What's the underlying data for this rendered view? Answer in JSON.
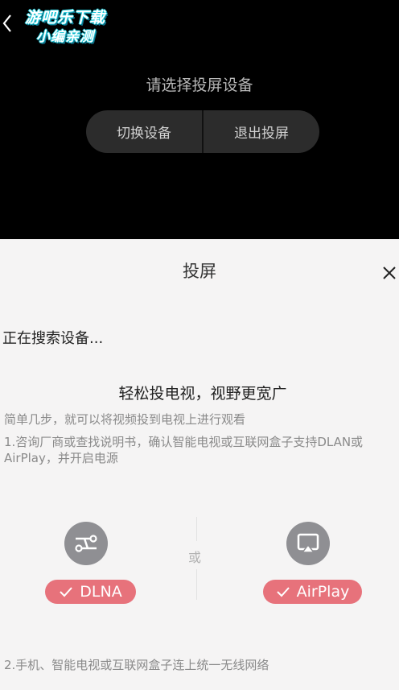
{
  "watermark": {
    "line1": "游吧乐下载",
    "line2": "小编亲测"
  },
  "player": {
    "back_icon": "chevron-left-icon",
    "prompt": "请选择投屏设备",
    "switch_device": "切换设备",
    "exit_cast": "退出投屏"
  },
  "sheet": {
    "title": "投屏",
    "close_icon": "close-icon",
    "searching": "正在搜索设备...",
    "headline": "轻松投电视，视野更宽广",
    "subtitle": "简单几步，就可以将视频投到电视上进行观看",
    "step1": "1.咨询厂商或查找说明书，确认智能电视或互联网盒子支持DLAN或AirPlay，并开启电源",
    "or": "或",
    "dlna": "DLNA",
    "airplay": "AirPlay",
    "step2": "2.手机、智能电视或互联网盒子连上统一无线网络"
  },
  "colors": {
    "tag": "#e7727b",
    "icon_circle": "#8f8f93",
    "sheet_bg": "#f5f4f4"
  }
}
